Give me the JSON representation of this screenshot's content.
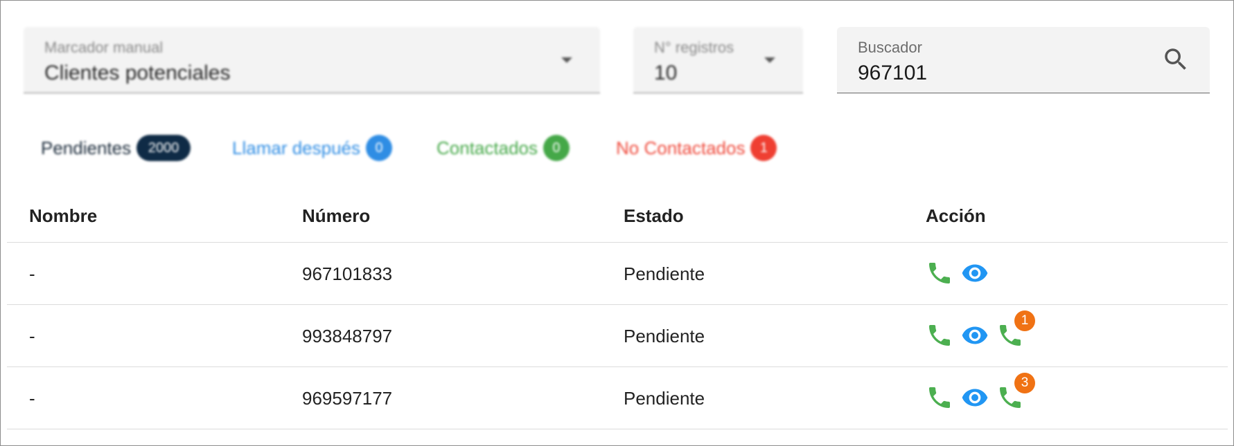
{
  "filters": {
    "marcador": {
      "label": "Marcador manual",
      "value": "Clientes potenciales"
    },
    "registros": {
      "label": "N° registros",
      "value": "10"
    },
    "buscador": {
      "label": "Buscador",
      "value": "967101",
      "icon": "search-icon"
    }
  },
  "status_chips": [
    {
      "label": "Pendientes",
      "count": "2000",
      "color": "#0f2b46"
    },
    {
      "label": "Llamar después",
      "count": "0",
      "color": "#2f8de4"
    },
    {
      "label": "Contactados",
      "count": "0",
      "color": "#45a848"
    },
    {
      "label": "No Contactados",
      "count": "1",
      "color": "#ef3f32"
    }
  ],
  "table": {
    "headers": [
      "Nombre",
      "Número",
      "Estado",
      "Acción"
    ],
    "rows": [
      {
        "nombre": "-",
        "numero": "967101833",
        "estado": "Pendiente",
        "recall_count": null
      },
      {
        "nombre": "-",
        "numero": "993848797",
        "estado": "Pendiente",
        "recall_count": "1"
      },
      {
        "nombre": "-",
        "numero": "969597177",
        "estado": "Pendiente",
        "recall_count": "3"
      }
    ]
  },
  "colors": {
    "call_icon": "#4caf50",
    "view_icon": "#2196f3",
    "recall_badge": "#f07214"
  },
  "icons": [
    "phone-icon",
    "eye-icon",
    "search-icon",
    "chevron-down-icon"
  ]
}
